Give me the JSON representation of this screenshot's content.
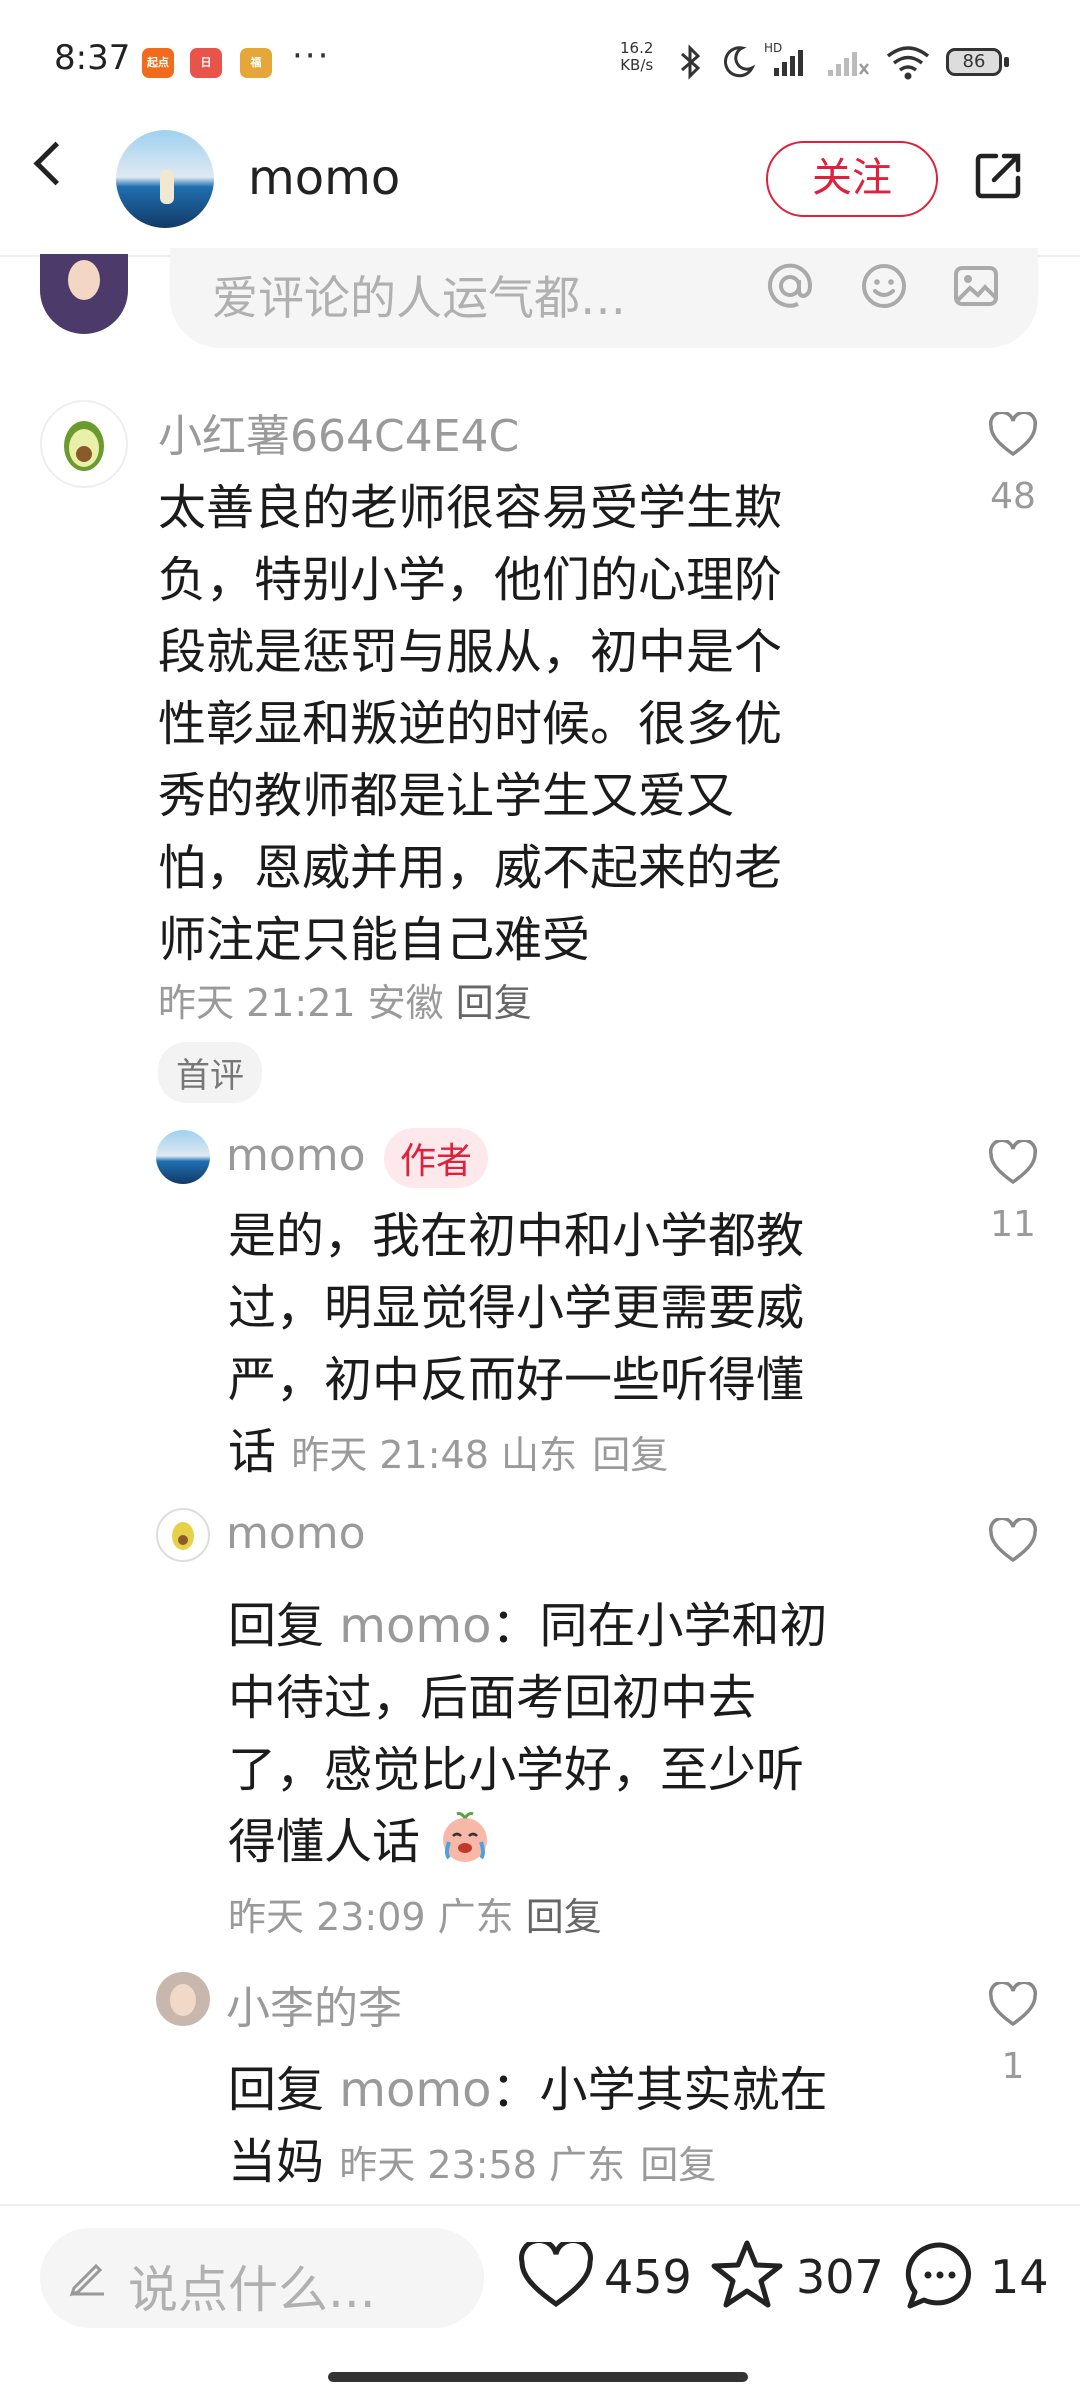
{
  "status_bar": {
    "time": "8:37",
    "app_badges": [
      "起点",
      "日",
      "福"
    ],
    "more": "···",
    "net_speed_value": "16.2",
    "net_speed_unit": "KB/s",
    "battery": "86",
    "accent": "#e0213c"
  },
  "header": {
    "title": "momo",
    "follow_label": "关注"
  },
  "comment_input": {
    "placeholder": "爱评论的人运气都…"
  },
  "comments": {
    "main": {
      "user": "小红薯664C4E4C",
      "text_lines": [
        "太善良的老师很容易受学生欺",
        "负，特别小学，他们的心理阶",
        "段就是惩罚与服从，初中是个",
        "性彰显和叛逆的时候。很多优",
        "秀的教师都是让学生又爱又",
        "怕，恩威并用，威不起来的老",
        "师注定只能自己难受"
      ],
      "meta": "昨天 21:21 安徽",
      "reply_label": "回复",
      "likes": "48",
      "tag": "首评"
    },
    "reply1": {
      "user": "momo",
      "author_tag": "作者",
      "text_lines": [
        "是的，我在初中和小学都教",
        "过，明显觉得小学更需要威",
        "严，初中反而好一些听得懂"
      ],
      "last_line": "话",
      "meta": "昨天 21:48 山东",
      "reply_label": "回复",
      "likes": "11"
    },
    "reply2": {
      "user": "momo",
      "reply_prefix": "回复",
      "reply_to": "momo",
      "colon": "：",
      "first_text": "同在小学和初",
      "text_lines": [
        "中待过，后面考回初中去",
        "了，感觉比小学好，至少听"
      ],
      "last_line": "得懂人话",
      "meta": "昨天 23:09 广东",
      "reply_label": "回复"
    },
    "reply3": {
      "user": "小李的李",
      "reply_prefix": "回复",
      "reply_to": "momo",
      "colon": "：",
      "first_text": "小学其实就在",
      "last_line": "当妈",
      "meta": "昨天 23:58 广东",
      "reply_label": "回复",
      "likes": "1"
    }
  },
  "bottom_bar": {
    "say_placeholder": "说点什么...",
    "likes": "459",
    "collects": "307",
    "comments": "14"
  }
}
